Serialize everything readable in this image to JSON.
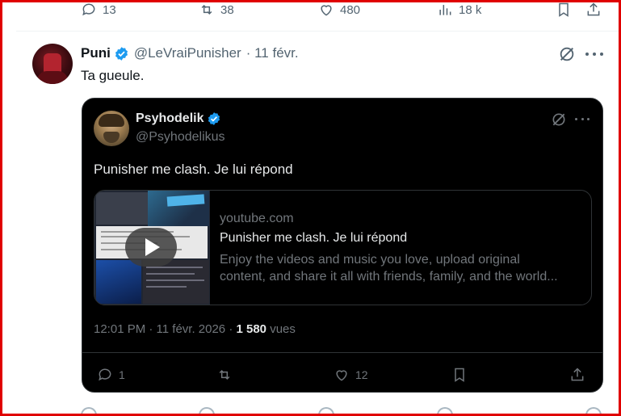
{
  "top_bar": {
    "replies": "13",
    "reposts": "38",
    "likes": "480",
    "views": "18 k"
  },
  "tweet": {
    "name": "Puni",
    "handle": "@LeVraiPunisher",
    "date": "· 11 févr.",
    "text": "Ta gueule."
  },
  "quote": {
    "name": "Psyhodelik",
    "handle": "@Psyhodelikus",
    "text": "Punisher me clash. Je lui répond",
    "card": {
      "domain": "youtube.com",
      "title": "Punisher me clash. Je lui répond",
      "desc_line1": "Enjoy the videos and music you love, upload original",
      "desc_line2": "content, and share it all with friends, family, and the world..."
    },
    "meta_time": "12:01 PM · 11 févr. 2026 · ",
    "meta_views_count": "1 580",
    "meta_views_label": " vues",
    "actions": {
      "replies": "1",
      "likes": "12"
    }
  },
  "colors": {
    "verified": "#1d9bf0",
    "border_accent": "#e00000",
    "secondary_text": "#536471",
    "dark_bg": "#000000"
  },
  "icons": [
    "reply-icon",
    "repost-icon",
    "like-icon",
    "views-icon",
    "bookmark-icon",
    "share-icon",
    "grok-icon",
    "more-icon",
    "verified-badge-icon",
    "play-icon"
  ]
}
